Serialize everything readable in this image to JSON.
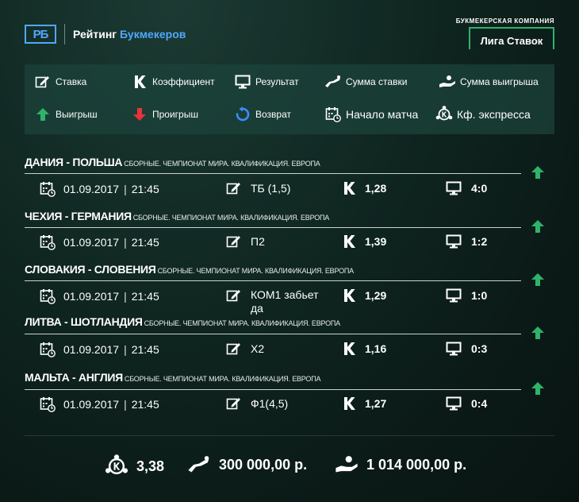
{
  "header": {
    "logo_text": "РБ",
    "title_plain": "Рейтинг",
    "title_accent": "Букмекеров",
    "bookmaker_caption": "БУКМЕКЕРСКАЯ КОМПАНИЯ",
    "bookmaker_name": "Лига Ставок"
  },
  "legend": {
    "bet": "Ставка",
    "coefficient": "Коэффициент",
    "result": "Результат",
    "stake_sum": "Сумма ставки",
    "win_sum": "Сумма выигрыша",
    "win": "Выигрыш",
    "loss": "Проигрыш",
    "refund": "Возврат",
    "match_start": "Начало матча",
    "express_coef": "Кф. экспресса"
  },
  "matches": [
    {
      "teams": "ДАНИЯ - ПОЛЬША",
      "league": "СБОРНЫЕ. ЧЕМПИОНАТ МИРА. КВАЛИФИКАЦИЯ. ЕВРОПА",
      "date": "01.09.2017",
      "time": "21:45",
      "bet": "ТБ (1,5)",
      "coef": "1,28",
      "result": "4:0",
      "outcome": "win"
    },
    {
      "teams": "ЧЕХИЯ - ГЕРМАНИЯ",
      "league": "СБОРНЫЕ. ЧЕМПИОНАТ МИРА. КВАЛИФИКАЦИЯ. ЕВРОПА",
      "date": "01.09.2017",
      "time": "21:45",
      "bet": "П2",
      "coef": "1,39",
      "result": "1:2",
      "outcome": "win"
    },
    {
      "teams": "СЛОВАКИЯ - СЛОВЕНИЯ",
      "league": "СБОРНЫЕ. ЧЕМПИОНАТ МИРА. КВАЛИФИКАЦИЯ. ЕВРОПА",
      "date": "01.09.2017",
      "time": "21:45",
      "bet_line1": "КОМ1 забьет",
      "bet_line2": "да",
      "coef": "1,29",
      "result": "1:0",
      "outcome": "win"
    },
    {
      "teams": "ЛИТВА - ШОТЛАНДИЯ",
      "league": "СБОРНЫЕ. ЧЕМПИОНАТ МИРА. КВАЛИФИКАЦИЯ. ЕВРОПА",
      "date": "01.09.2017",
      "time": "21:45",
      "bet": "Х2",
      "coef": "1,16",
      "result": "0:3",
      "outcome": "win"
    },
    {
      "teams": "МАЛЬТА - АНГЛИЯ",
      "league": "СБОРНЫЕ. ЧЕМПИОНАТ МИРА. КВАЛИФИКАЦИЯ. ЕВРОПА",
      "date": "01.09.2017",
      "time": "21:45",
      "bet": "Ф1(4,5)",
      "coef": "1,27",
      "result": "0:4",
      "outcome": "win"
    }
  ],
  "totals": {
    "express_coef": "3,38",
    "stake": "300 000,00 р.",
    "win": "1 014 000,00 р."
  },
  "icons": [
    "edit-icon",
    "coefficient-k-icon",
    "monitor-icon",
    "stake-hand-icon",
    "win-hand-icon",
    "win-arrow-icon",
    "loss-arrow-icon",
    "refund-icon",
    "calendar-icon",
    "express-icon"
  ],
  "colors": {
    "accent_blue": "#4fa8ff",
    "win_green": "#2fb36a",
    "loss_red": "#e8323c",
    "background": "#0f2520"
  }
}
